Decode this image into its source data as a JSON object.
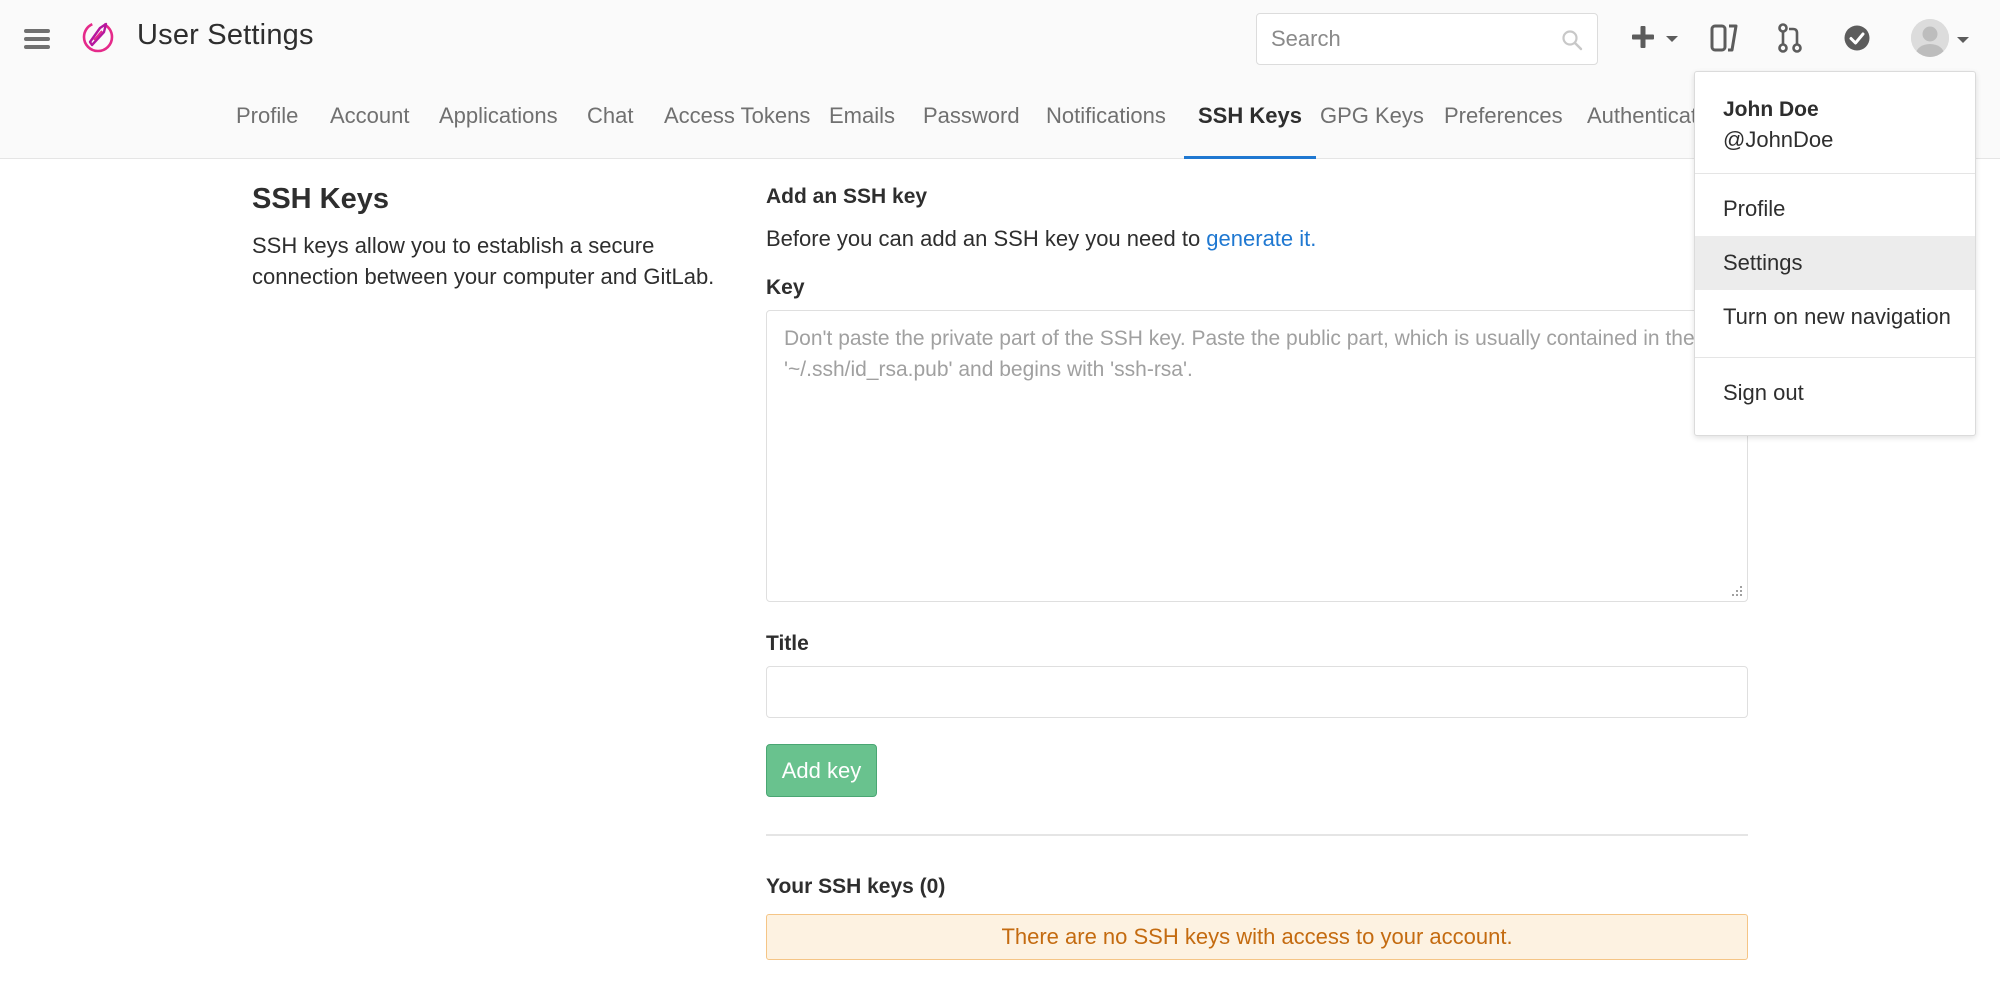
{
  "header": {
    "title": "User Settings",
    "search_placeholder": "Search",
    "icons": {
      "menu": "hamburger-menu-icon",
      "logo": "app-logo",
      "search": "search-icon",
      "new": "plus-icon",
      "layout": "layout-panel-icon",
      "merge_requests": "merge-request-icon",
      "todos": "check-circle-icon",
      "user": "avatar"
    }
  },
  "tabs": [
    {
      "label": "Profile"
    },
    {
      "label": "Account"
    },
    {
      "label": "Applications"
    },
    {
      "label": "Chat"
    },
    {
      "label": "Access Tokens"
    },
    {
      "label": "Emails"
    },
    {
      "label": "Password"
    },
    {
      "label": "Notifications"
    },
    {
      "label": "SSH Keys",
      "active": true
    },
    {
      "label": "GPG Keys"
    },
    {
      "label": "Preferences"
    },
    {
      "label": "Authenticat"
    }
  ],
  "sidebar": {
    "title": "SSH Keys",
    "description": "SSH keys allow you to establish a secure connection between your computer and GitLab."
  },
  "form": {
    "heading": "Add an SSH key",
    "help_text": "Before you can add an SSH key you need to ",
    "help_link": "generate it.",
    "key_label": "Key",
    "key_placeholder": "Don't paste the private part of the SSH key. Paste the public part, which is usually contained in the file '~/.ssh/id_rsa.pub' and begins with 'ssh-rsa'.",
    "key_value": "",
    "title_label": "Title",
    "title_value": "",
    "submit_label": "Add key"
  },
  "keys": {
    "heading": "Your SSH keys (0)",
    "empty_message": "There are no SSH keys with access to your account."
  },
  "user_menu": {
    "name": "John Doe",
    "username": "@JohnDoe",
    "items": [
      {
        "label": "Profile"
      },
      {
        "label": "Settings",
        "highlighted": true
      },
      {
        "label": "Turn on new navigation"
      },
      {
        "label": "Sign out"
      }
    ]
  },
  "colors": {
    "accent": "#1f78d1",
    "success_button": "#69c28e",
    "warning_bg": "#fdf2e1",
    "warning_text": "#c46b10",
    "logo": "#e52a8a"
  }
}
